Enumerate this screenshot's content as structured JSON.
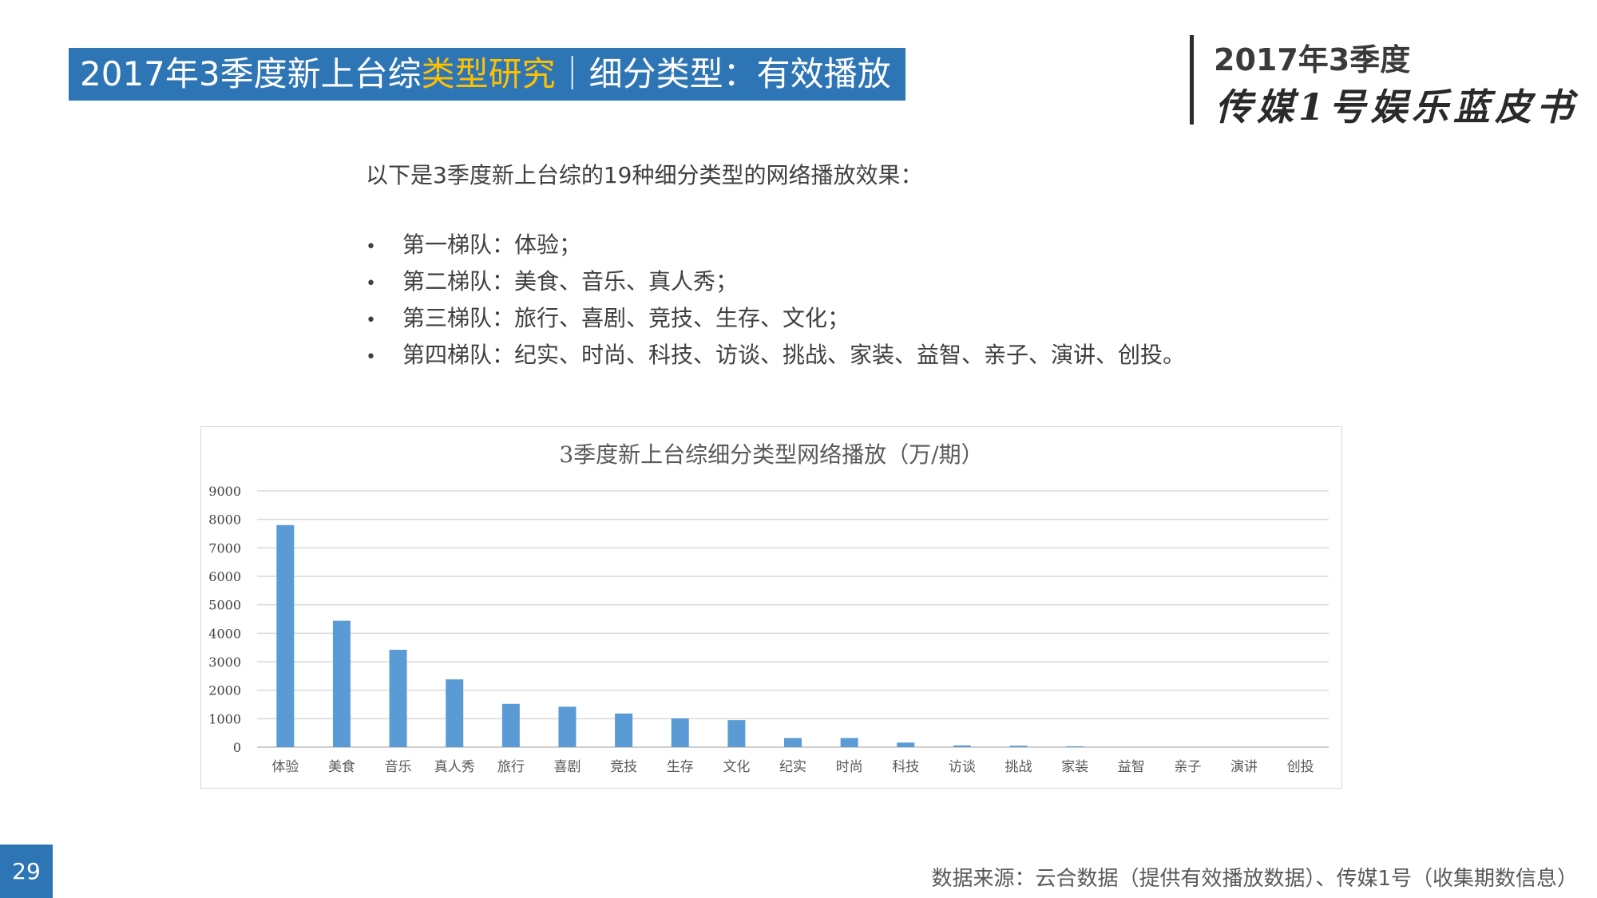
{
  "header": {
    "title_prefix": "2017年3季度新上台综",
    "title_highlight": "类型研究",
    "title_suffix": "｜细分类型：有效播放",
    "brand_year": "2017年3季度",
    "brand_name": "传媒1号娱乐蓝皮书"
  },
  "intro": "以下是3季度新上台综的19种细分类型的网络播放效果：",
  "bullets": [
    "第一梯队：体验；",
    "第二梯队：美食、音乐、真人秀；",
    "第三梯队：旅行、喜剧、竞技、生存、文化；",
    "第四梯队：纪实、时尚、科技、访谈、挑战、家装、益智、亲子、演讲、创投。"
  ],
  "bullet_glyph": "•",
  "chart_data": {
    "type": "bar",
    "title": "3季度新上台综细分类型网络播放（万/期）",
    "categories": [
      "体验",
      "美食",
      "音乐",
      "真人秀",
      "旅行",
      "喜剧",
      "竞技",
      "生存",
      "文化",
      "纪实",
      "时尚",
      "科技",
      "访谈",
      "挑战",
      "家装",
      "益智",
      "亲子",
      "演讲",
      "创投"
    ],
    "values": [
      7800,
      4440,
      3420,
      2380,
      1520,
      1420,
      1180,
      1010,
      950,
      320,
      320,
      160,
      60,
      50,
      30,
      0,
      0,
      0,
      0
    ],
    "ylim": [
      0,
      9000
    ],
    "yticks": [
      0,
      1000,
      2000,
      3000,
      4000,
      5000,
      6000,
      7000,
      8000,
      9000
    ],
    "grid": true,
    "bar_color": "#5b9bd5",
    "xlabel": "",
    "ylabel": ""
  },
  "footer": {
    "page_number": "29",
    "source": "数据来源：云合数据（提供有效播放数据）、传媒1号（收集期数信息）"
  },
  "colors": {
    "accent": "#2e75b6",
    "highlight": "#ffc000"
  }
}
